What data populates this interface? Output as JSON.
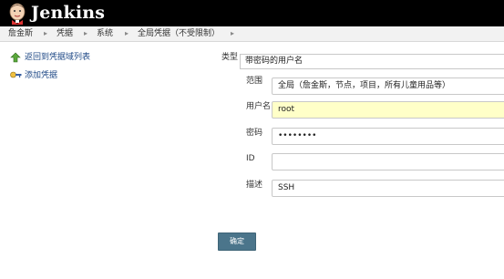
{
  "header": {
    "app_title": "Jenkins",
    "logo_icon": "jenkins-butler-logo"
  },
  "breadcrumb": {
    "items": [
      "詹金斯",
      "凭据",
      "系统",
      "全局凭据（不受限制）"
    ],
    "separator_icon": "chevron-right-icon"
  },
  "sidebar": {
    "items": [
      {
        "label": "返回到凭据域列表",
        "icon": "arrow-up-icon"
      },
      {
        "label": "添加凭据",
        "icon": "key-icon"
      }
    ]
  },
  "form": {
    "kind": {
      "label": "类型",
      "value": "带密码的用户名"
    },
    "scope": {
      "label": "范围",
      "value": "全局（詹金斯，节点，项目，所有儿童用品等）"
    },
    "username": {
      "label": "用户名",
      "value": "root"
    },
    "password": {
      "label": "密码",
      "value": "••••••••"
    },
    "id": {
      "label": "ID",
      "value": ""
    },
    "description": {
      "label": "描述",
      "value": "SSH"
    },
    "submit_label": "确定"
  },
  "colors": {
    "header_bg": "#000000",
    "link": "#204a87",
    "button_bg": "#4b758b",
    "autofill_bg": "#ffffc8"
  }
}
